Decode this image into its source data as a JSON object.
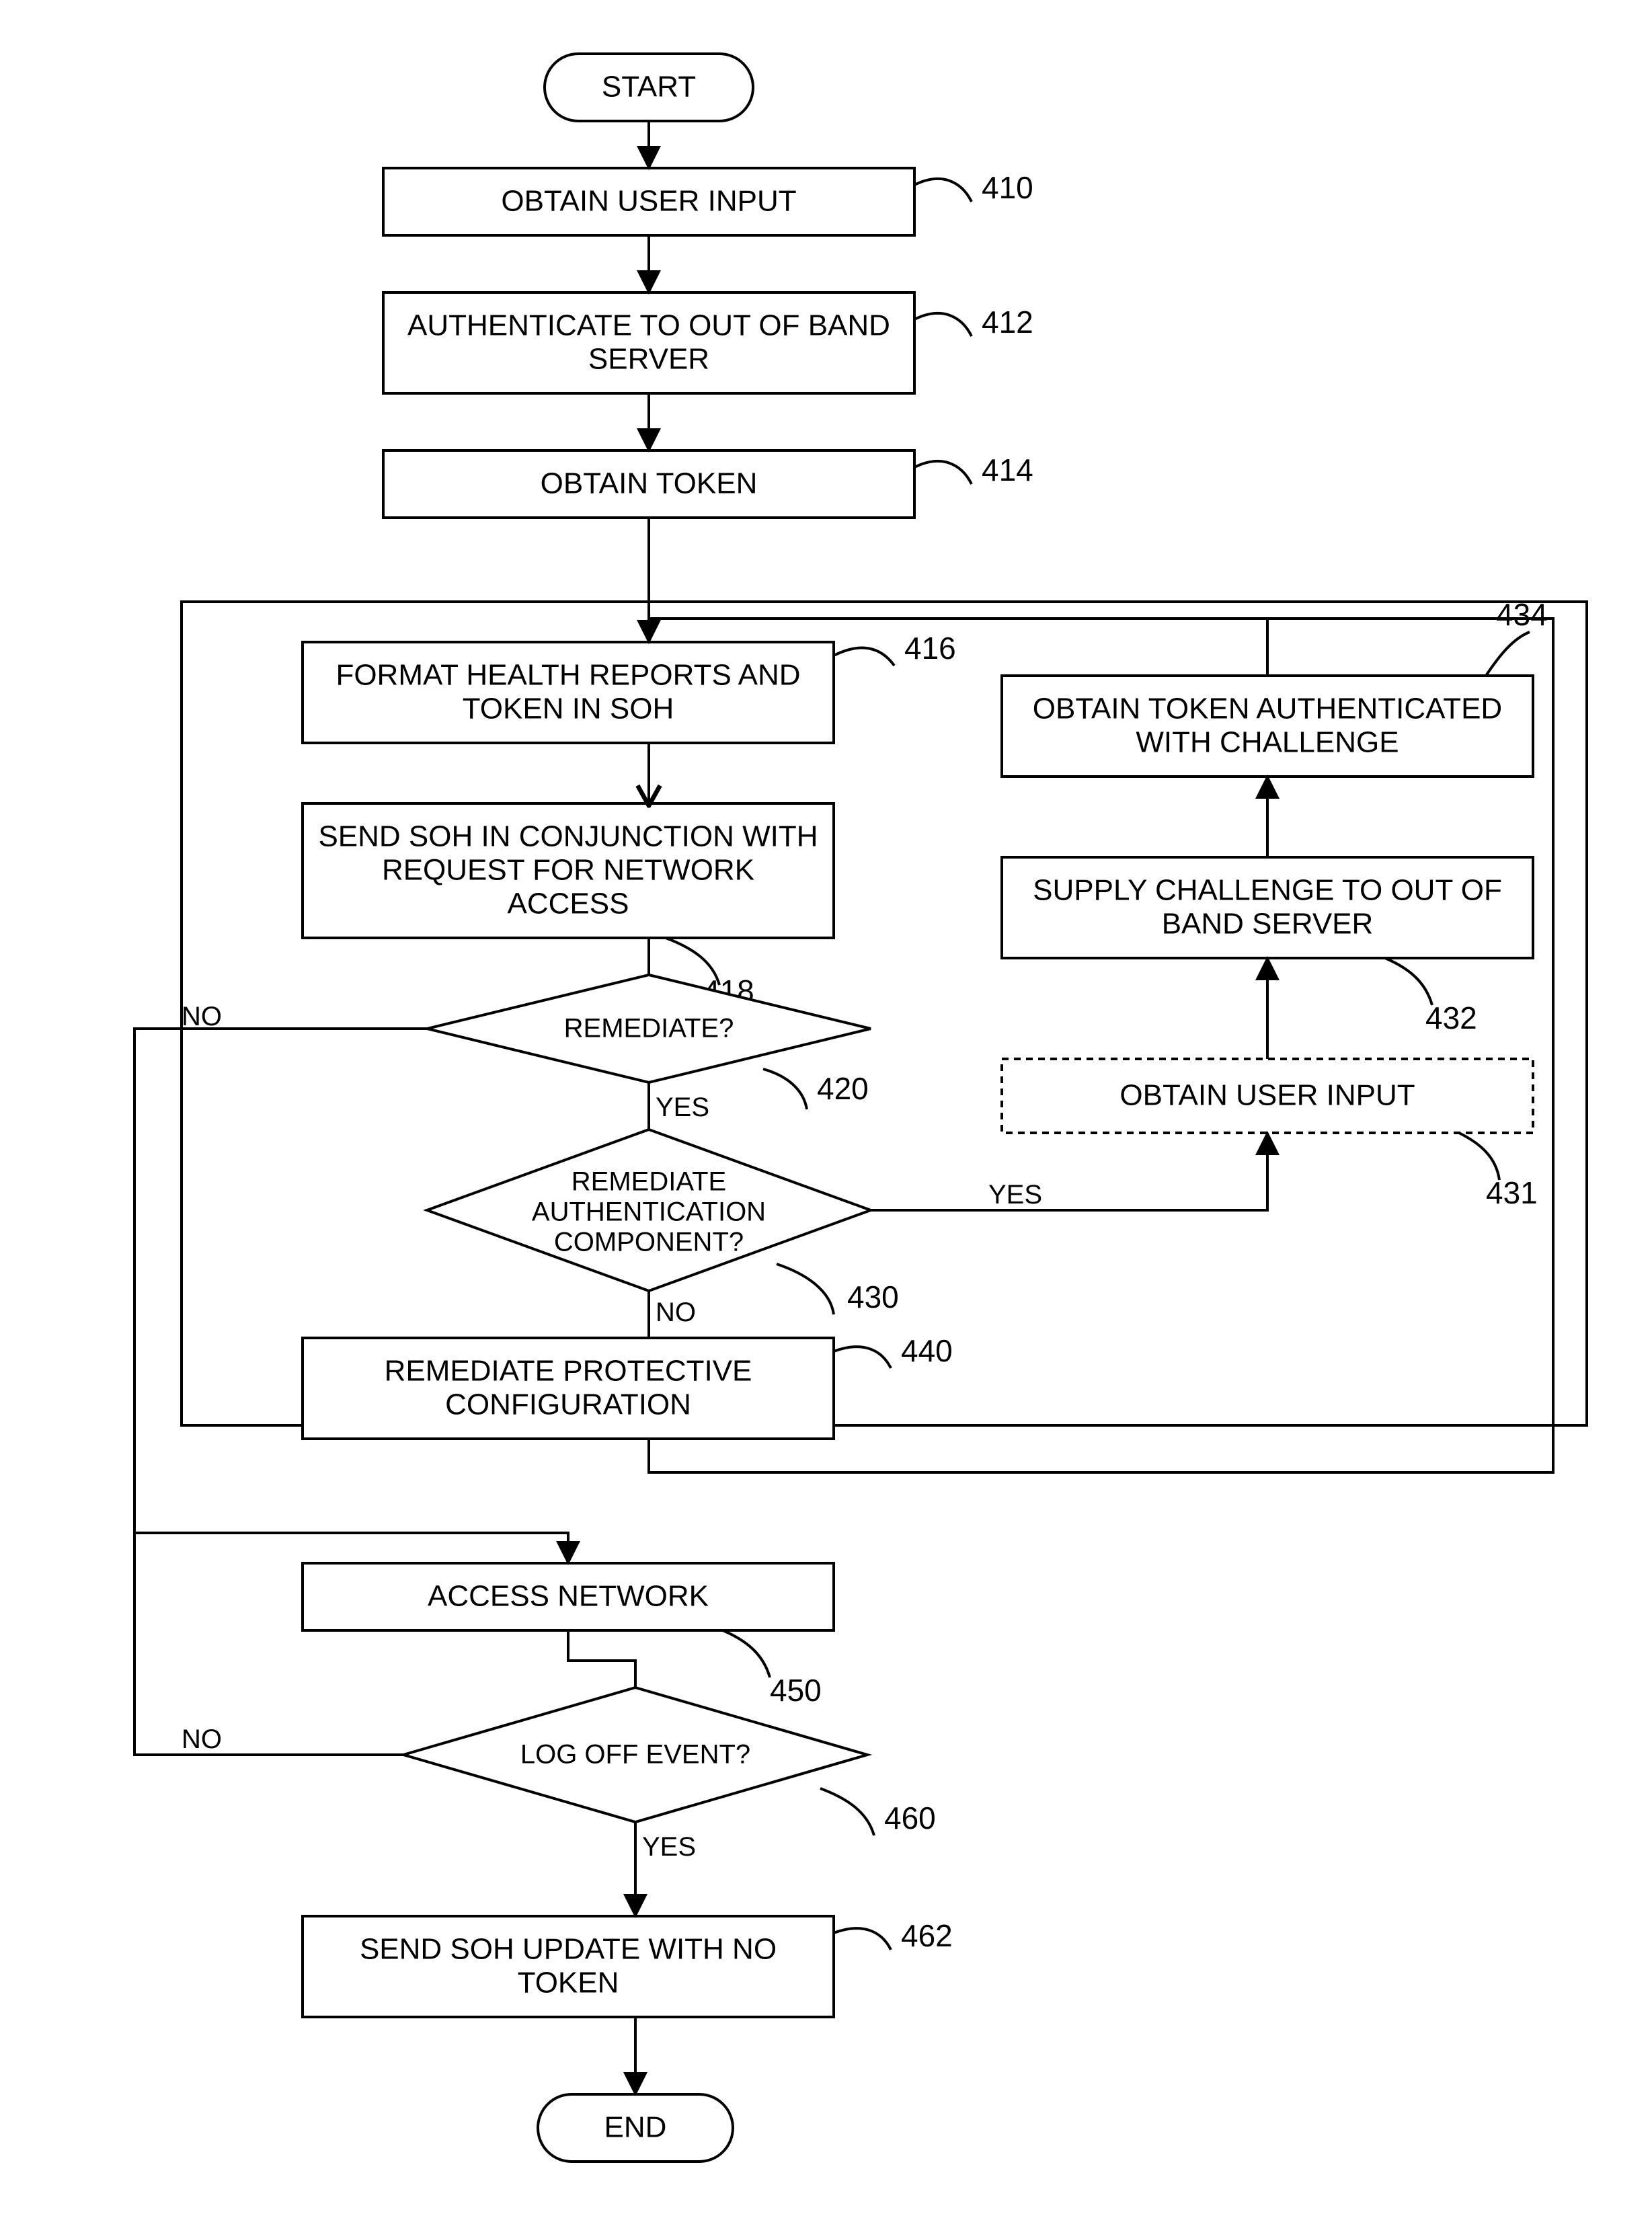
{
  "terminals": {
    "start": "START",
    "end": "END"
  },
  "boxes": {
    "b410": {
      "l1": "OBTAIN USER INPUT"
    },
    "b412": {
      "l1": "AUTHENTICATE TO OUT OF BAND",
      "l2": "SERVER"
    },
    "b414": {
      "l1": "OBTAIN TOKEN"
    },
    "b416": {
      "l1": "FORMAT HEALTH REPORTS AND",
      "l2": "TOKEN IN SOH"
    },
    "b418": {
      "l1": "SEND SOH IN CONJUNCTION WITH",
      "l2": "REQUEST FOR NETWORK",
      "l3": "ACCESS"
    },
    "b434": {
      "l1": "OBTAIN TOKEN AUTHENTICATED",
      "l2": "WITH CHALLENGE"
    },
    "b432": {
      "l1": "SUPPLY CHALLENGE TO OUT OF",
      "l2": "BAND SERVER"
    },
    "b431": {
      "l1": "OBTAIN USER INPUT"
    },
    "b440": {
      "l1": "REMEDIATE PROTECTIVE",
      "l2": "CONFIGURATION"
    },
    "b450": {
      "l1": "ACCESS NETWORK"
    },
    "b462": {
      "l1": "SEND SOH UPDATE WITH NO",
      "l2": "TOKEN"
    }
  },
  "decisions": {
    "d420": {
      "l1": "REMEDIATE?"
    },
    "d430": {
      "l1": "REMEDIATE",
      "l2": "AUTHENTICATION",
      "l3": "COMPONENT?"
    },
    "d460": {
      "l1": "LOG OFF EVENT?"
    }
  },
  "refs": {
    "r410": "410",
    "r412": "412",
    "r414": "414",
    "r416": "416",
    "r418": "418",
    "r420": "420",
    "r430": "430",
    "r431": "431",
    "r432": "432",
    "r434": "434",
    "r440": "440",
    "r450": "450",
    "r460": "460",
    "r462": "462"
  },
  "yn": {
    "yes": "YES",
    "no": "NO"
  }
}
